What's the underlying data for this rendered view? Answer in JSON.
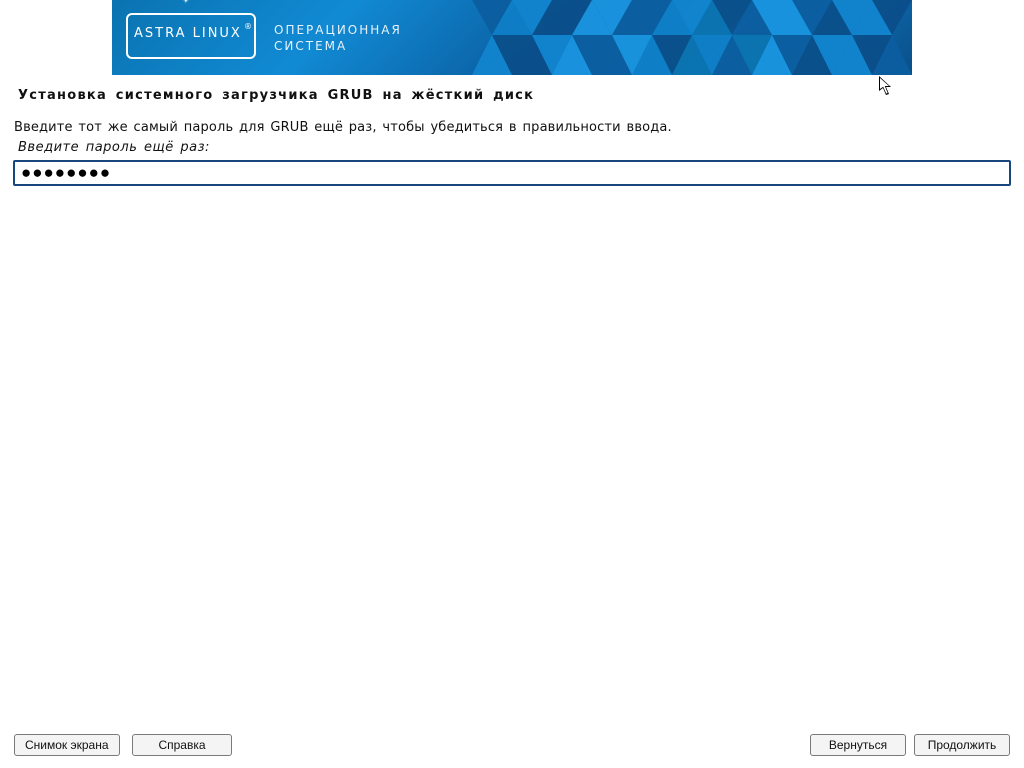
{
  "banner": {
    "logo_text": "ASTRA LINUX",
    "registered": "®",
    "subtitle_line1": "ОПЕРАЦИОННАЯ",
    "subtitle_line2": "СИСТЕМА"
  },
  "page": {
    "title": "Установка системного загрузчика GRUB на жёсткий диск",
    "instruction": "Введите тот же самый пароль для GRUB ещё раз, чтобы убедиться в правильности ввода.",
    "field_label": "Введите пароль ещё раз:",
    "password_mask": "●●●●●●●●"
  },
  "footer": {
    "screenshot": "Снимок экрана",
    "help": "Справка",
    "back": "Вернуться",
    "continue": "Продолжить"
  }
}
